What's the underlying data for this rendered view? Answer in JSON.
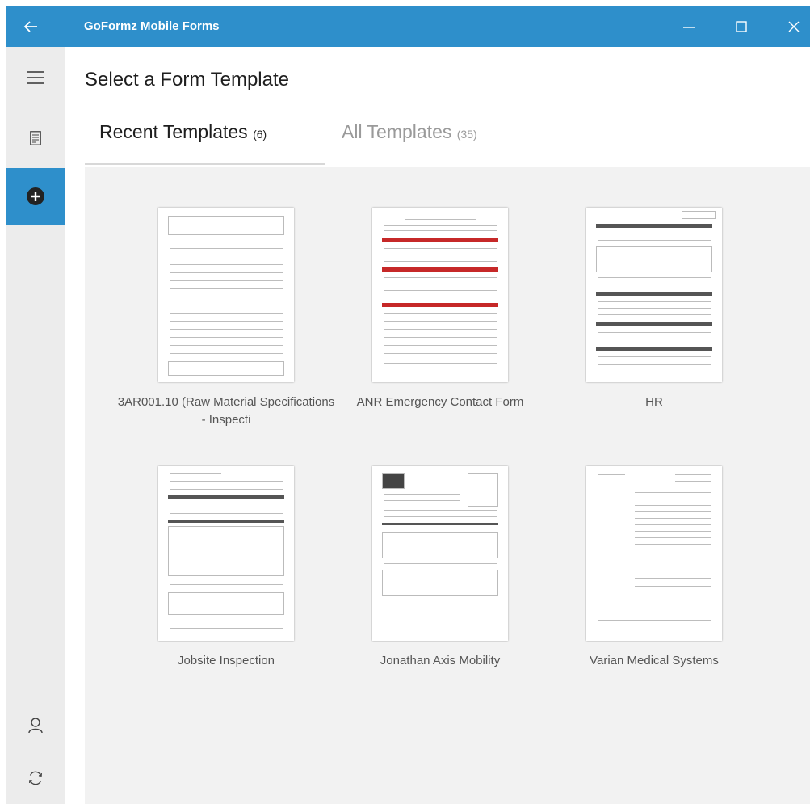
{
  "window": {
    "title": "GoFormz Mobile Forms"
  },
  "page": {
    "title": "Select a Form Template"
  },
  "tabs": {
    "recent": {
      "label": "Recent Templates",
      "count": "(6)"
    },
    "all": {
      "label": "All Templates",
      "count": "(35)"
    }
  },
  "templates": [
    {
      "label": "3AR001.10 (Raw Material Specifications - Inspecti"
    },
    {
      "label": "ANR Emergency Contact Form"
    },
    {
      "label": "HR"
    },
    {
      "label": "Jobsite Inspection"
    },
    {
      "label": "Jonathan Axis Mobility"
    },
    {
      "label": "Varian Medical Systems"
    }
  ],
  "icons": {
    "back": "arrow-left-icon",
    "minimize": "minimize-icon",
    "maximize": "maximize-icon",
    "close": "close-icon",
    "menu": "hamburger-menu-icon",
    "forms": "document-icon",
    "new": "plus-circle-icon",
    "user": "user-icon",
    "sync": "sync-icon"
  },
  "colors": {
    "accent": "#2e8fcb",
    "sidebar": "#ececec",
    "content_bg": "#f2f2f2"
  }
}
